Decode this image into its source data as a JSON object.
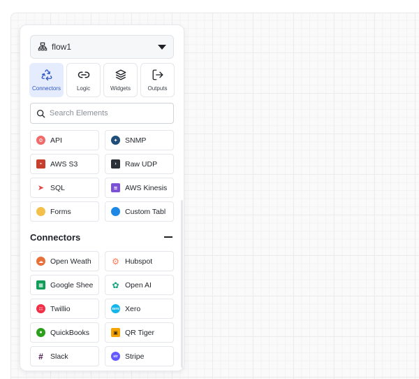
{
  "flow": {
    "name": "flow1"
  },
  "tabs": [
    {
      "label": "Connectors",
      "icon": "recycle-icon",
      "active": true
    },
    {
      "label": "Logic",
      "icon": "link-icon",
      "active": false
    },
    {
      "label": "Widgets",
      "icon": "layers-icon",
      "active": false
    },
    {
      "label": "Outputs",
      "icon": "log-out-icon",
      "active": false
    }
  ],
  "search": {
    "placeholder": "Search Elements"
  },
  "top_items": [
    {
      "label": "API",
      "icon": "api-icon",
      "color": "#f06a6a"
    },
    {
      "label": "SNMP",
      "icon": "snmp-icon",
      "color": "#1f4e79"
    },
    {
      "label": "AWS S3",
      "icon": "aws-s3-icon",
      "color": "#c7402d"
    },
    {
      "label": "Raw UDP",
      "icon": "terminal-icon",
      "color": "#2b2f36"
    },
    {
      "label": "SQL",
      "icon": "sql-icon",
      "color": "#e04848"
    },
    {
      "label": "AWS Kinesis",
      "icon": "aws-kinesis-icon",
      "color": "#7b52d6"
    },
    {
      "label": "Forms",
      "icon": "forms-icon",
      "color": "#f3c04a"
    },
    {
      "label": "Custom Tabl",
      "icon": "custom-table-icon",
      "color": "#1e88e5"
    }
  ],
  "connectors_section": {
    "title": "Connectors",
    "items": [
      {
        "label": "Open Weath",
        "icon": "open-weather-icon",
        "color": "#e8703a"
      },
      {
        "label": "Hubspot",
        "icon": "hubspot-icon",
        "color": "#ff7a59"
      },
      {
        "label": "Google Shee",
        "icon": "google-sheets-icon",
        "color": "#0f9d58"
      },
      {
        "label": "Open AI",
        "icon": "openai-icon",
        "color": "#10a37f"
      },
      {
        "label": "Twillio",
        "icon": "twilio-icon",
        "color": "#f22f46"
      },
      {
        "label": "Xero",
        "icon": "xero-icon",
        "color": "#13b5ea"
      },
      {
        "label": "QuickBooks",
        "icon": "quickbooks-icon",
        "color": "#2ca01c"
      },
      {
        "label": "QR Tiger",
        "icon": "qr-tiger-icon",
        "color": "#f5a300"
      },
      {
        "label": "Slack",
        "icon": "slack-icon",
        "color": "#4a154b"
      },
      {
        "label": "Stripe",
        "icon": "stripe-icon",
        "color": "#635bff"
      }
    ]
  }
}
